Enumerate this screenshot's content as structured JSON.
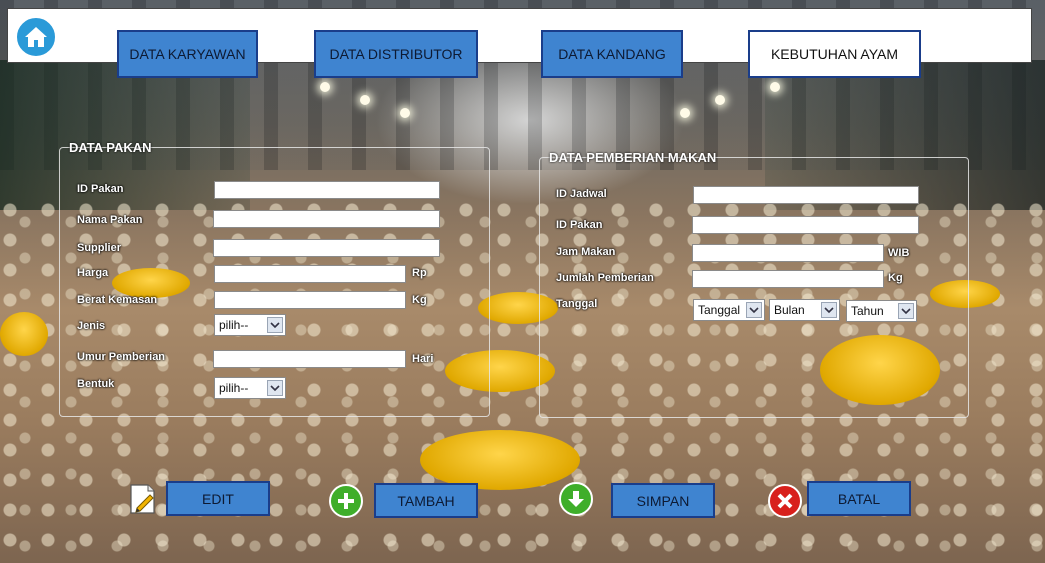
{
  "nav": {
    "karyawan": "DATA KARYAWAN",
    "distributor": "DATA DISTRIBUTOR",
    "kandang": "DATA KANDANG",
    "kebutuhan": "KEBUTUHAN AYAM"
  },
  "pakan": {
    "title": "DATA PAKAN",
    "id_label": "ID Pakan",
    "nama_label": "Nama Pakan",
    "supplier_label": "Supplier",
    "harga_label": "Harga",
    "harga_unit": "Rp",
    "berat_label": "Berat Kemasan",
    "berat_unit": "Kg",
    "jenis_label": "Jenis",
    "jenis_value": "pilih--",
    "umur_label": "Umur Pemberian",
    "umur_unit": "Hari",
    "bentuk_label": "Bentuk",
    "bentuk_value": "pilih--"
  },
  "pemberian": {
    "title": "DATA PEMBERIAN MAKAN",
    "id_jadwal_label": "ID Jadwal",
    "id_pakan_label": "ID Pakan",
    "jam_label": "Jam Makan",
    "jam_unit": "WIB",
    "jumlah_label": "Jumlah Pemberian",
    "jumlah_unit": "Kg",
    "tanggal_label": "Tanggal",
    "tanggal_value": "Tanggal",
    "bulan_value": "Bulan",
    "tahun_value": "Tahun"
  },
  "actions": {
    "edit": "EDIT",
    "tambah": "TAMBAH",
    "simpan": "SIMPAN",
    "batal": "BATAL"
  },
  "colors": {
    "nav_button": "#3f84d0",
    "nav_border": "#1a3d8a",
    "home": "#2a9ad8",
    "add_icon": "#3fae2a",
    "save_icon": "#3fae2a",
    "cancel_icon": "#d8201c"
  },
  "icons": {
    "home": "home-icon",
    "edit": "pencil-icon",
    "tambah": "plus-icon",
    "simpan": "arrow-down-icon",
    "batal": "close-icon"
  }
}
